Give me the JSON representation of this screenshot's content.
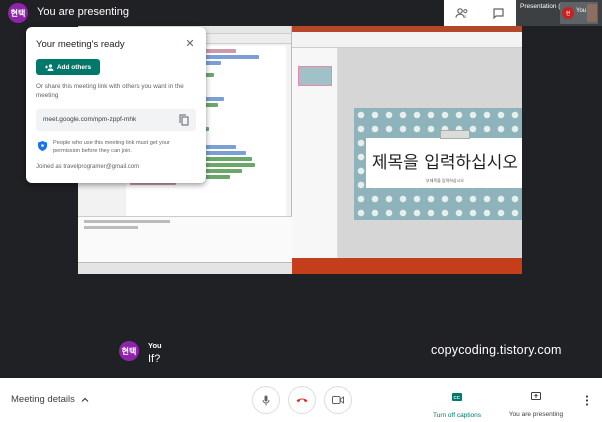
{
  "top_bar": {
    "avatar_initials": "현택",
    "title": "You are presenting",
    "people_icon": "people-icon",
    "chat_icon": "chat-icon",
    "self_tile_label": "Presentation (You)",
    "self_tile_you": "You"
  },
  "shared_screen": {
    "slide_title": "제목을 입력하십시오",
    "slide_subtitle": "부제목을 입력하십시오"
  },
  "meeting_card": {
    "title": "Your meeting's ready",
    "add_others_label": "Add others",
    "share_text": "Or share this meeting link with others you want in the meeting",
    "meeting_link": "meet.google.com/npm-zppf-mhk",
    "permission_text": "People who use this meeting link must get your permission before they can join.",
    "joined_as": "Joined as travelprogramer@gmail.com"
  },
  "caption": {
    "avatar_initials": "현택",
    "speaker": "You",
    "text": "If?"
  },
  "watermark": "copycoding.tistory.com",
  "bottom_bar": {
    "meeting_details_label": "Meeting details",
    "turn_off_captions_label": "Turn off captions",
    "you_are_presenting_label": "You are presenting"
  },
  "colors": {
    "accent": "#00796b",
    "end_call": "#d93025",
    "avatar": "#8e24aa",
    "background": "#202124"
  }
}
